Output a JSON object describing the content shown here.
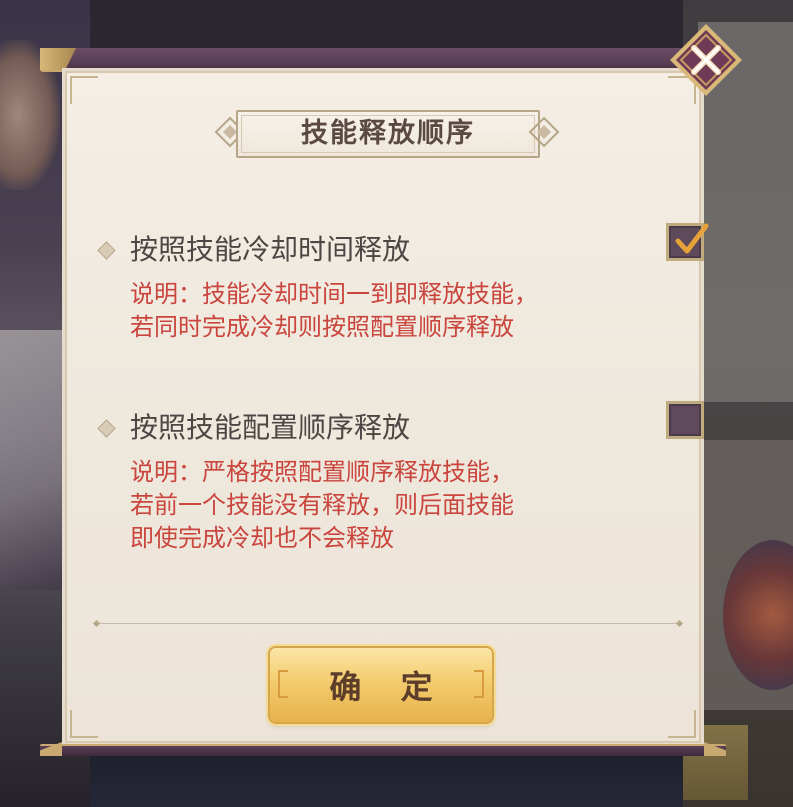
{
  "dialog": {
    "title": "技能释放顺序",
    "confirm_label": "确 定",
    "close_icon": "close-icon"
  },
  "options": [
    {
      "label": "按照技能冷却时间释放",
      "checked": true,
      "desc_lines": [
        "说明：技能冷却时间一到即释放技能，",
        "若同时完成冷却则按照配置顺序释放"
      ]
    },
    {
      "label": "按照技能配置顺序释放",
      "checked": false,
      "desc_lines": [
        "说明：严格按照配置顺序释放技能，",
        "若前一个技能没有释放，则后面技能",
        "即使完成冷却也不会释放"
      ]
    }
  ],
  "colors": {
    "panel_bg": "#f0e9df",
    "frame": "#5a3f56",
    "gold": "#c9a972",
    "desc_red": "#c9453d",
    "label_text": "#4e4544",
    "checkbox_fill": "#5e4a5a",
    "check_mark": "#e8a23a",
    "button_gold": "#f3cc6d"
  }
}
